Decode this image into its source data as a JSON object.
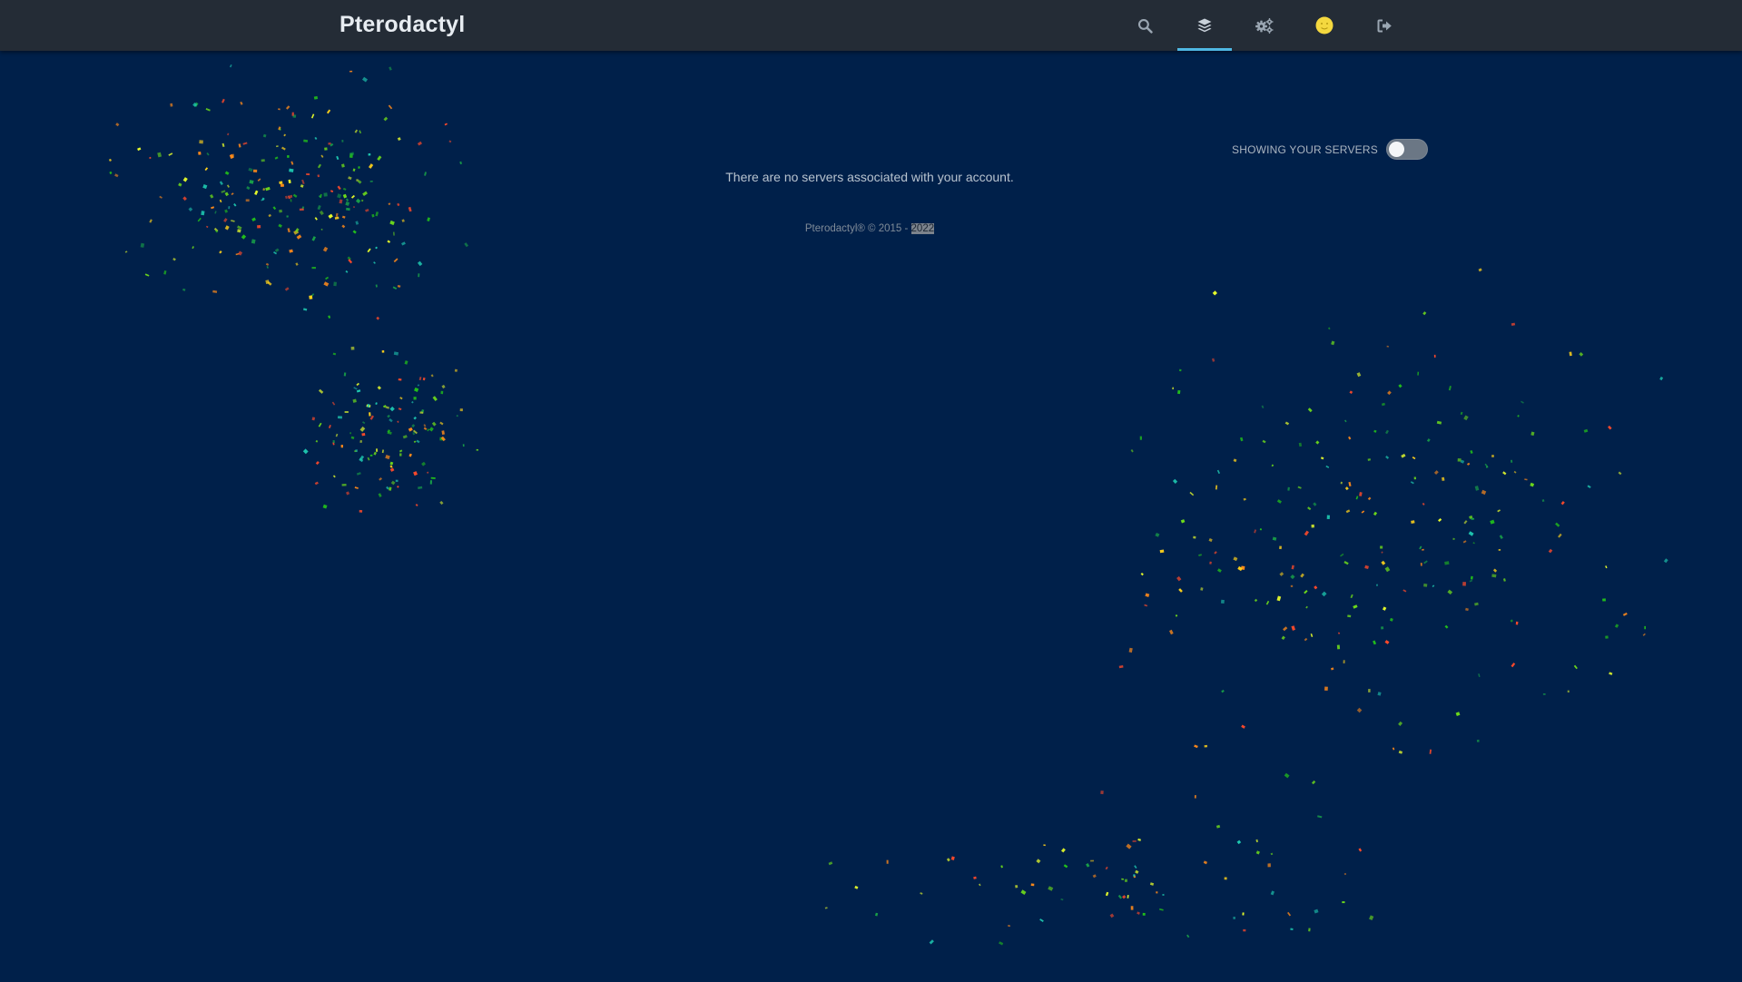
{
  "app": {
    "brand": "Pterodactyl"
  },
  "nav": {
    "items": [
      {
        "name": "search-icon",
        "active": false
      },
      {
        "name": "layers-icon",
        "active": true
      },
      {
        "name": "cogs-icon",
        "active": false
      },
      {
        "name": "user-avatar-icon",
        "active": false
      },
      {
        "name": "sign-out-icon",
        "active": false
      }
    ],
    "accent_color": "#4fb8e3"
  },
  "main": {
    "toggle_label": "Showing your servers",
    "toggle_on": false,
    "empty_message": "There are no servers associated with your account."
  },
  "footer": {
    "prefix": "Pterodactyl® © 2015 - ",
    "year_highlighted": "2022"
  },
  "colors": {
    "background": "#00204a",
    "navbar": "#242c36",
    "confetti": [
      "#ff4a2a",
      "#ff8a1a",
      "#ffd21a",
      "#e9ff2a",
      "#6edc1a",
      "#22c21a",
      "#18a048",
      "#1ec8b0"
    ]
  }
}
